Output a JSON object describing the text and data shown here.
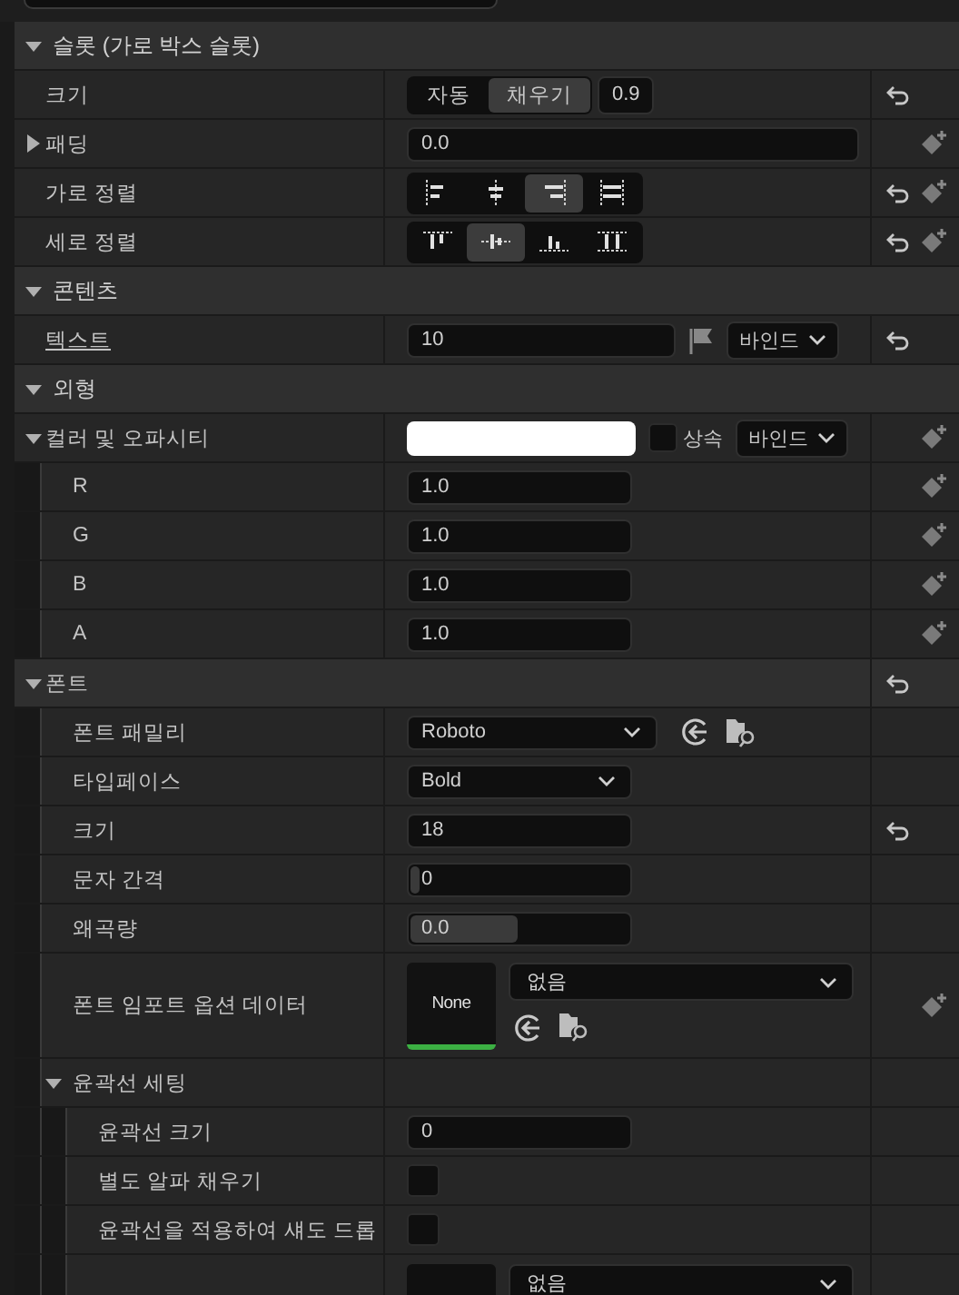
{
  "sections": [
    {
      "title": "슬롯 (가로 박스 슬롯)",
      "expanded": true,
      "rows": [
        {
          "label": "크기",
          "kind": "size",
          "options": [
            {
              "label": "자동",
              "selected": false
            },
            {
              "label": "채우기",
              "selected": true
            }
          ],
          "value": "0.9",
          "reset": true,
          "keyframe": false
        },
        {
          "label": "패딩",
          "kind": "struct",
          "expanded": false,
          "value": "0.0",
          "reset": false,
          "keyframe": true
        },
        {
          "label": "가로 정렬",
          "kind": "align-h",
          "options": [
            {
              "selected": false
            },
            {
              "selected": false
            },
            {
              "selected": true
            },
            {
              "selected": false
            }
          ],
          "reset": true,
          "keyframe": true
        },
        {
          "label": "세로 정렬",
          "kind": "align-v",
          "options": [
            {
              "selected": false
            },
            {
              "selected": true
            },
            {
              "selected": false
            },
            {
              "selected": false
            }
          ],
          "reset": true,
          "keyframe": true
        }
      ]
    },
    {
      "title": "콘텐츠",
      "expanded": true,
      "rows": [
        {
          "label": "텍스트",
          "kind": "text-bind",
          "underlined": true,
          "value": "10",
          "bind": "바인드",
          "reset": true,
          "keyframe": false
        }
      ]
    },
    {
      "title": "외형",
      "expanded": true,
      "rows": [
        {
          "label": "컬러 및 오파시티",
          "kind": "color",
          "expanded": true,
          "color": "#ffffff",
          "inherit": {
            "label": "상속",
            "checked": false
          },
          "bind": "바인드",
          "reset": false,
          "keyframe": true,
          "children": [
            {
              "label": "R",
              "kind": "number",
              "value": "1.0",
              "reset": false,
              "keyframe": true
            },
            {
              "label": "G",
              "kind": "number",
              "value": "1.0",
              "reset": false,
              "keyframe": true
            },
            {
              "label": "B",
              "kind": "number",
              "value": "1.0",
              "reset": false,
              "keyframe": true
            },
            {
              "label": "A",
              "kind": "number",
              "value": "1.0",
              "reset": false,
              "keyframe": true
            }
          ]
        },
        {
          "label": "폰트",
          "kind": "category",
          "expanded": true,
          "reset": true,
          "keyframe": false,
          "children": [
            {
              "label": "폰트 패밀리",
              "kind": "asset-combo",
              "value": "Roboto",
              "reset": false,
              "keyframe": false
            },
            {
              "label": "타입페이스",
              "kind": "combo",
              "value": "Bold",
              "reset": false,
              "keyframe": false
            },
            {
              "label": "크기",
              "kind": "number",
              "value": "18",
              "reset": true,
              "keyframe": false
            },
            {
              "label": "문자 간격",
              "kind": "slider",
              "value": "0",
              "level": 0,
              "reset": false,
              "keyframe": false
            },
            {
              "label": "왜곡량",
              "kind": "slider",
              "value": "0.0",
              "level": 0.48,
              "reset": false,
              "keyframe": false
            },
            {
              "label": "폰트 임포트 옵션 데이터",
              "kind": "asset",
              "thumbnail": "None",
              "value": "없음",
              "reset": false,
              "keyframe": true
            },
            {
              "label": "윤곽선 세팅",
              "kind": "group",
              "expanded": true,
              "reset": false,
              "keyframe": false,
              "children": [
                {
                  "label": "윤곽선 크기",
                  "kind": "number",
                  "value": "0",
                  "reset": false,
                  "keyframe": false
                },
                {
                  "label": "별도 알파 채우기",
                  "kind": "checkbox",
                  "checked": false,
                  "reset": false,
                  "keyframe": false
                },
                {
                  "label": "윤곽선을 적용하여 섀도 드롭",
                  "kind": "checkbox",
                  "checked": false,
                  "reset": false,
                  "keyframe": false
                },
                {
                  "kind": "asset",
                  "value": "없음"
                }
              ]
            }
          ]
        }
      ]
    }
  ]
}
